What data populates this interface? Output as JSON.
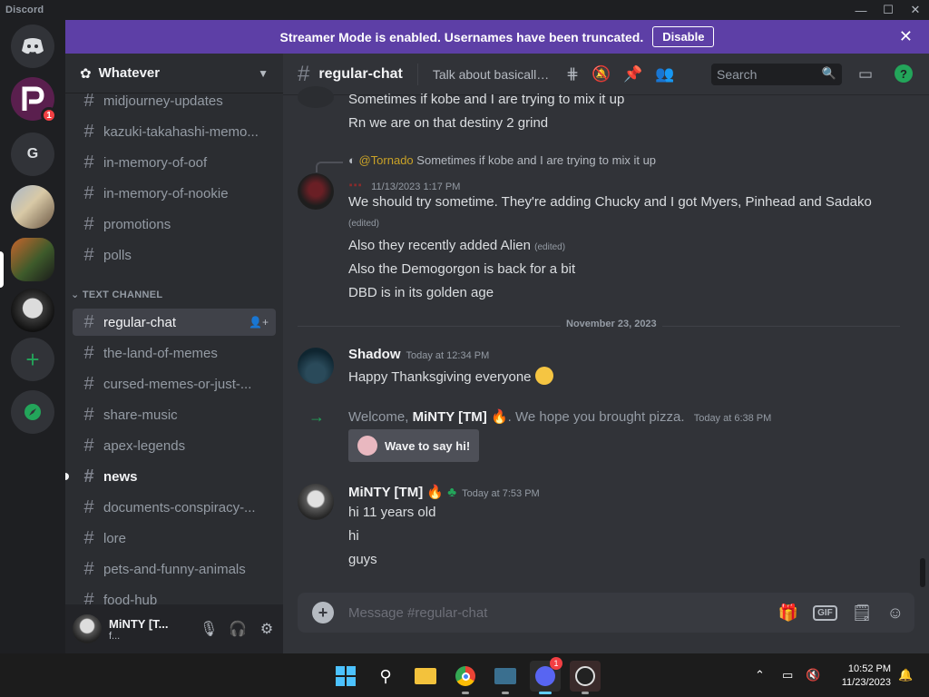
{
  "window": {
    "title": "Discord"
  },
  "banner": {
    "text": "Streamer Mode is enabled. Usernames have been truncated.",
    "button": "Disable"
  },
  "servers": {
    "g_label": "G",
    "p_badge": "1"
  },
  "guild": {
    "name": "Whatever"
  },
  "channels": {
    "top": [
      "midjourney-updates",
      "kazuki-takahashi-memo...",
      "in-memory-of-oof",
      "in-memory-of-nookie",
      "promotions",
      "polls"
    ],
    "category": "TEXT CHANNEL",
    "text": [
      "regular-chat",
      "the-land-of-memes",
      "cursed-memes-or-just-...",
      "share-music",
      "apex-legends",
      "news",
      "documents-conspiracy-...",
      "lore",
      "pets-and-funny-animals",
      "food-hub"
    ],
    "active": "regular-chat",
    "unread": "news"
  },
  "user": {
    "name": "MiNTY [T...",
    "status": "f..."
  },
  "header": {
    "channel": "regular-chat",
    "topic": "Talk about basically ...",
    "search_placeholder": "Search"
  },
  "messages": {
    "m0_line1": "Sometimes if kobe and I are trying to mix it up",
    "m0_line2": "Rn we are on that destiny 2 grind",
    "reply_mention": "@Tornado",
    "reply_text": "Sometimes if kobe and I are trying to mix it up",
    "m1_ts": "11/13/2023 1:17 PM",
    "m1_line1": "We should try sometime. They're adding Chucky and I got Myers, Pinhead and Sadako",
    "edited": "(edited)",
    "m1_line2": "Also they recently added Alien",
    "m1_line3": "Also the Demogorgon is back for a bit",
    "m1_line4": "DBD is in its golden age",
    "date_divider": "November 23, 2023",
    "shadow_name": "Shadow",
    "shadow_ts": "Today at 12:34 PM",
    "shadow_text": "Happy Thanksgiving everyone",
    "join_pre": "Welcome,",
    "join_name": "MiNTY [TM]",
    "join_post": ". We hope you brought pizza.",
    "join_ts": "Today at 6:38 PM",
    "wave_label": "Wave to say hi!",
    "minty_name": "MiNTY [TM]",
    "minty_ts": "Today at 7:53 PM",
    "minty_l1": "hi 11 years old",
    "minty_l2": "hi",
    "minty_l3": "guys"
  },
  "composer": {
    "placeholder": "Message #regular-chat",
    "gif": "GIF"
  },
  "taskbar": {
    "time": "10:52 PM",
    "date": "11/23/2023",
    "discord_badge": "1"
  }
}
